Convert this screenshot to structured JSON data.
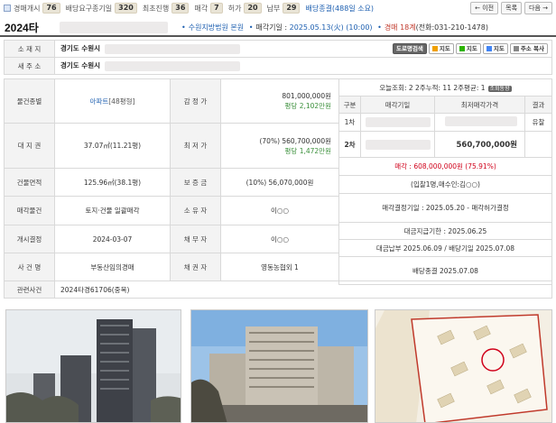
{
  "topbar": {
    "stats": [
      {
        "label": "경매개시",
        "value": "76"
      },
      {
        "label": "배당요구종기일",
        "value": "320"
      },
      {
        "label": "최초진행",
        "value": "36"
      },
      {
        "label": "매각",
        "value": "7"
      },
      {
        "label": "허가",
        "value": "20"
      },
      {
        "label": "납부",
        "value": "29"
      }
    ],
    "last_label": "배당종결(488일 소요)",
    "prev": "← 이전",
    "list": "목록",
    "next": "다음 →"
  },
  "case": {
    "number": "2024타",
    "court": "수원지방법원 본원",
    "sale_date_label": "매각기일 :",
    "sale_date": "2025.05.13(火) (10:00)",
    "dept": "경매 18계",
    "phone": "(전화:031-210-1478)"
  },
  "address": {
    "location_label": "소 재 지",
    "location_value": "경기도 수원시",
    "new_label": "새 주 소",
    "new_value": "경기도 수원시",
    "buttons": [
      "도로명검색",
      "지도",
      "지도",
      "지도",
      "주소 복사"
    ]
  },
  "details": {
    "type_label": "물건종별",
    "type_value": "아파트",
    "type_size": "[48평형]",
    "appraisal_label": "감 정 가",
    "appraisal_value": "801,000,000원",
    "appraisal_unit": "평당 2,102만원",
    "land_label": "대 지 권",
    "land_value": "37.07㎡(11.21평)",
    "min_label": "최 저 가",
    "min_value": "(70%) 560,700,000원",
    "min_unit": "평당 1,472만원",
    "building_label": "건물면적",
    "building_value": "125.96㎡(38.1평)",
    "deposit_label": "보 증 금",
    "deposit_value": "(10%) 56,070,000원",
    "sale_obj_label": "매각물건",
    "sale_obj_value": "토지·건물 일괄매각",
    "owner_label": "소 유 자",
    "owner_value": "이○○",
    "open_label": "개시결정",
    "open_value": "2024-03-07",
    "debtor_label": "채 무 자",
    "debtor_value": "이○○",
    "case_label": "사 건 명",
    "case_value": "부동산임의경매",
    "creditor_label": "채 권 자",
    "creditor_value": "영동농협외 1",
    "related_label": "관련사건",
    "related_value": "2024타경61706(중복)"
  },
  "history": {
    "views": "오늘조회: 2  2주누적: 11  2주평균: 1",
    "views_btn": "조회동향",
    "col_round": "구분",
    "col_date": "매각기일",
    "col_min": "최저매각가격",
    "col_result": "결과",
    "rows": [
      {
        "round": "1차",
        "min": "",
        "result": "유찰"
      },
      {
        "round": "2차",
        "min": "560,700,000원",
        "result": ""
      }
    ],
    "sold": "매각 : 608,000,000원 (75.91%)",
    "bidders": "(입찰1명,매수인:김○○)",
    "decision": "매각결정기일 : 2025.05.20 - 매각허가결정",
    "payment_due": "대금지급기한 : 2025.06.25",
    "payment": "대금납부 2025.06.09 / 배당기일 2025.07.08",
    "closed": "배당종결 2025.07.08"
  },
  "colors": {
    "accent_blue": "#1d5fb0",
    "red": "#d0021b",
    "green": "#3a8f3a"
  }
}
